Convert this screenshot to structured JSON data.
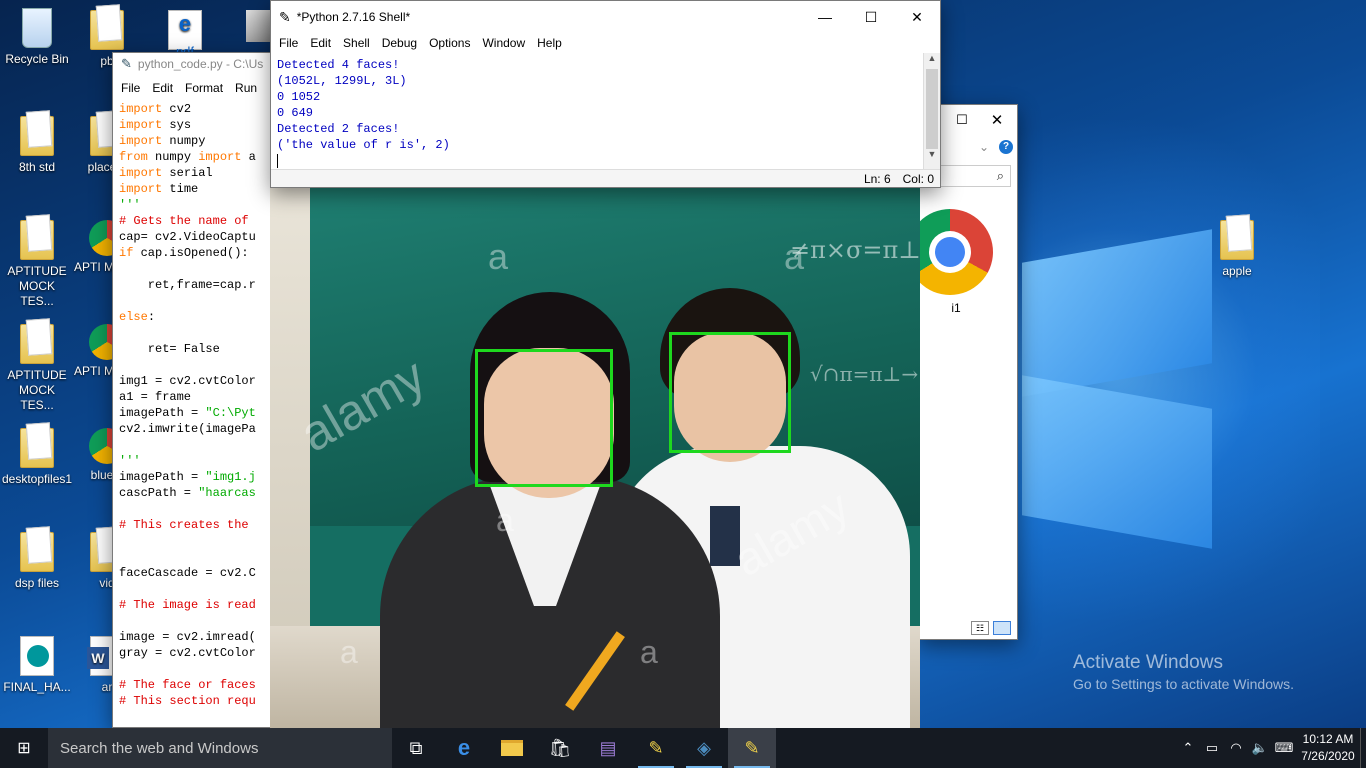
{
  "desktop_icons": [
    {
      "label": "Recycle Bin",
      "icon": "recycle-bin-icon"
    },
    {
      "label": "pb",
      "icon": "file-icon"
    },
    {
      "label": "pdf",
      "icon": "edge-pdf-icon"
    },
    {
      "label": "8th std",
      "icon": "folder-icon"
    },
    {
      "label": "placem",
      "icon": "folder-icon"
    },
    {
      "label": "APTITUDE MOCK TES...",
      "icon": "folder-icon"
    },
    {
      "label": "APTI MOCK",
      "icon": "chrome-icon"
    },
    {
      "label": "APTITUDE MOCK TES...",
      "icon": "folder-icon"
    },
    {
      "label": "APTI MOCK",
      "icon": "chrome-icon"
    },
    {
      "label": "desktopfiles1",
      "icon": "folder-icon"
    },
    {
      "label": "blueto",
      "icon": "chrome-icon"
    },
    {
      "label": "dsp files",
      "icon": "folder-icon"
    },
    {
      "label": "vid",
      "icon": "folder-icon"
    },
    {
      "label": "FINAL_HA...",
      "icon": "arduino-icon"
    },
    {
      "label": "ar",
      "icon": "word-icon"
    },
    {
      "label": "apple",
      "icon": "image-folder-icon"
    }
  ],
  "editor": {
    "title": "python_code.py - C:\\Us",
    "menu": [
      "File",
      "Edit",
      "Format",
      "Run"
    ],
    "lines": [
      [
        [
          "kw",
          "import"
        ],
        [
          "",
          " cv2"
        ]
      ],
      [
        [
          "kw",
          "import"
        ],
        [
          "",
          " sys"
        ]
      ],
      [
        [
          "kw",
          "import"
        ],
        [
          "",
          " numpy"
        ]
      ],
      [
        [
          "kw",
          "from"
        ],
        [
          "",
          " numpy "
        ],
        [
          "kw",
          "import"
        ],
        [
          "",
          " a"
        ]
      ],
      [
        [
          "kw",
          "import"
        ],
        [
          "",
          " serial"
        ]
      ],
      [
        [
          "kw",
          "import"
        ],
        [
          "",
          " time"
        ]
      ],
      [
        [
          "st",
          "'''"
        ]
      ],
      [
        [
          "cm",
          "# Gets the name of"
        ]
      ],
      [
        [
          "",
          "cap= cv2.VideoCaptu"
        ]
      ],
      [
        [
          "kw",
          "if"
        ],
        [
          "",
          " cap.isOpened():"
        ]
      ],
      [
        [
          "",
          ""
        ]
      ],
      [
        [
          "",
          "    ret,frame=cap.r"
        ]
      ],
      [
        [
          "",
          ""
        ]
      ],
      [
        [
          "kw",
          "else"
        ],
        [
          "",
          ":"
        ]
      ],
      [
        [
          "",
          ""
        ]
      ],
      [
        [
          "",
          "    ret= False"
        ]
      ],
      [
        [
          "",
          ""
        ]
      ],
      [
        [
          "",
          "img1 = cv2.cvtColor"
        ]
      ],
      [
        [
          "",
          "a1 = frame"
        ]
      ],
      [
        [
          "",
          "imagePath = "
        ],
        [
          "st",
          "\"C:\\Pyt"
        ]
      ],
      [
        [
          "",
          "cv2.imwrite(imagePa"
        ]
      ],
      [
        [
          "",
          ""
        ]
      ],
      [
        [
          "st",
          "'''"
        ]
      ],
      [
        [
          "",
          "imagePath = "
        ],
        [
          "st",
          "\"img1.j"
        ]
      ],
      [
        [
          "",
          "cascPath = "
        ],
        [
          "st",
          "\"haarcas"
        ]
      ],
      [
        [
          "",
          ""
        ]
      ],
      [
        [
          "cm",
          "# This creates the"
        ]
      ],
      [
        [
          "",
          ""
        ]
      ],
      [
        [
          "",
          ""
        ]
      ],
      [
        [
          "",
          "faceCascade = cv2.C"
        ]
      ],
      [
        [
          "",
          ""
        ]
      ],
      [
        [
          "cm",
          "# The image is read"
        ]
      ],
      [
        [
          "",
          ""
        ]
      ],
      [
        [
          "",
          "image = cv2.imread("
        ]
      ],
      [
        [
          "",
          "gray = cv2.cvtColor"
        ]
      ],
      [
        [
          "",
          ""
        ]
      ],
      [
        [
          "cm",
          "# The face or faces"
        ]
      ],
      [
        [
          "cm",
          "# This section requ"
        ]
      ]
    ]
  },
  "shell": {
    "title": "*Python 2.7.16 Shell*",
    "menu": [
      "File",
      "Edit",
      "Shell",
      "Debug",
      "Options",
      "Window",
      "Help"
    ],
    "output": [
      "Detected 4 faces!",
      "(1052L, 1299L, 3L)",
      "0 1052",
      "0 649",
      "Detected 2 faces!",
      "('the value of r is', 2)"
    ],
    "status": {
      "ln": "Ln: 6",
      "col": "Col: 0"
    }
  },
  "image_window": {
    "watermarks": [
      "a",
      "a",
      "alamy",
      "a",
      "alamy",
      "a",
      "a"
    ],
    "board_text_1": "≠π⨯σ=π⊥→⨯σ",
    "board_text_2": "√∩π=π⊥→⨯σ"
  },
  "explorer": {
    "file_label": "i1"
  },
  "activation": {
    "title": "Activate Windows",
    "subtitle": "Go to Settings to activate Windows."
  },
  "taskbar": {
    "search_placeholder": "Search the web and Windows",
    "time": "10:12 AM",
    "date": "7/26/2020"
  }
}
